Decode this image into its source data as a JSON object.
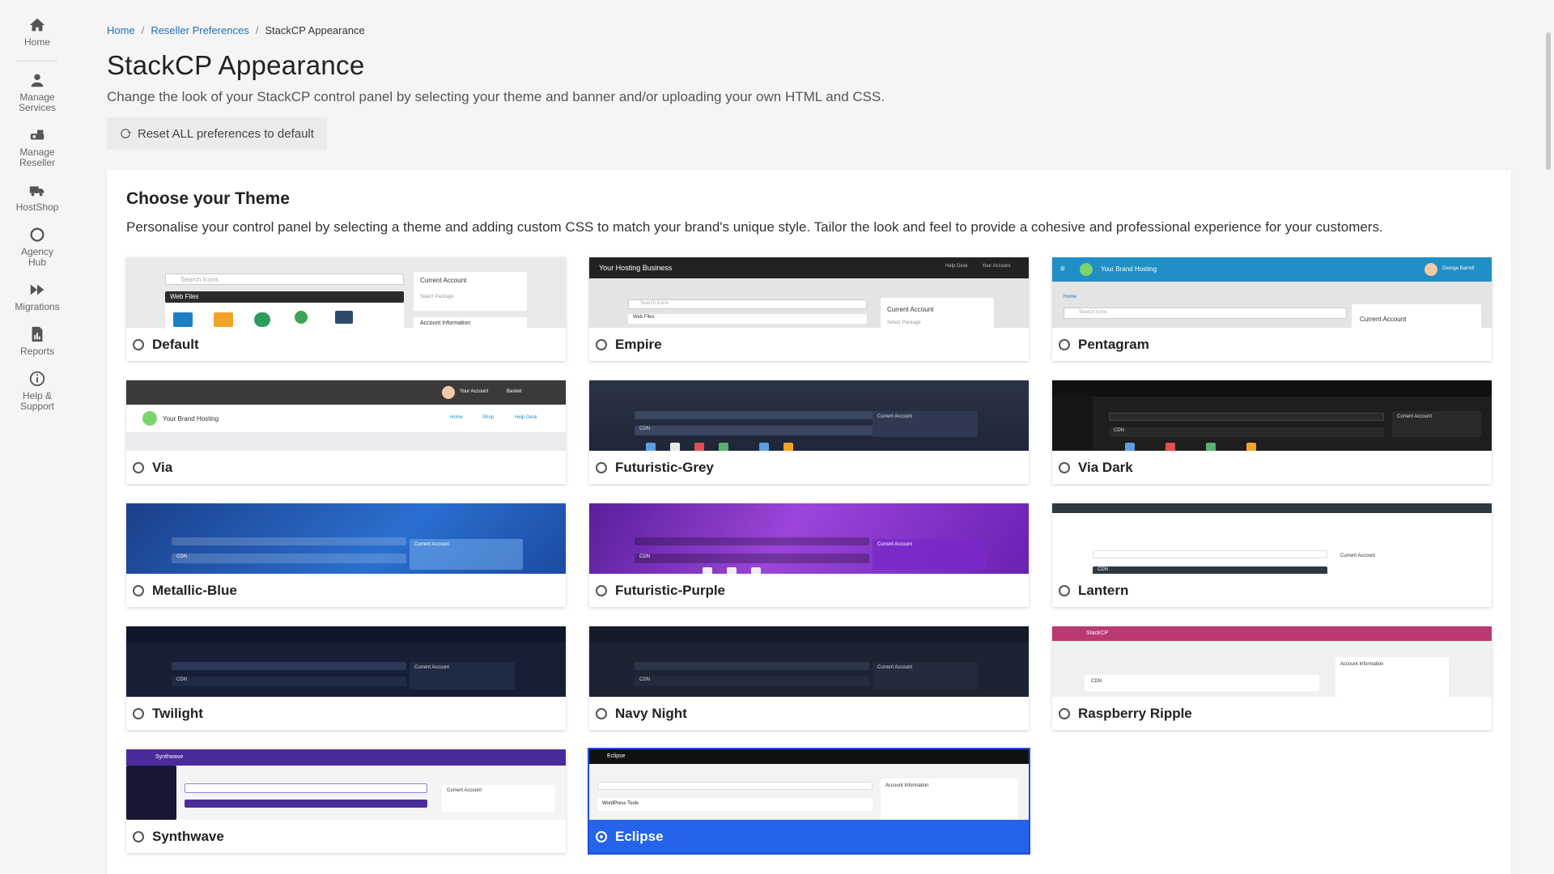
{
  "sidebar": {
    "items": [
      {
        "label": "Home",
        "icon": "home-icon"
      },
      {
        "label": "Manage Services",
        "icon": "user-gear-icon"
      },
      {
        "label": "Manage Reseller",
        "icon": "reseller-icon"
      },
      {
        "label": "HostShop",
        "icon": "truck-icon"
      },
      {
        "label": "Agency Hub",
        "icon": "circle-icon"
      },
      {
        "label": "Migrations",
        "icon": "forward-icon"
      },
      {
        "label": "Reports",
        "icon": "report-icon"
      },
      {
        "label": "Help & Support",
        "icon": "info-icon"
      }
    ]
  },
  "breadcrumb": {
    "home": "Home",
    "parent": "Reseller Preferences",
    "current": "StackCP Appearance",
    "sep": "/"
  },
  "page": {
    "title": "StackCP Appearance",
    "subtitle": "Change the look of your StackCP control panel by selecting your theme and banner and/or uploading your own HTML and CSS.",
    "reset_label": "Reset ALL preferences to default"
  },
  "themes_card": {
    "title": "Choose your Theme",
    "description": "Personalise your control panel by selecting a theme and adding custom CSS to match your brand's unique style. Tailor the look and feel to provide a cohesive and professional experience for your customers.",
    "selected": "Eclipse",
    "themes": [
      {
        "name": "Default",
        "preview_texts": [
          "Search Icons",
          "Web Files",
          "Current Account",
          "Select Package",
          "Account Information"
        ]
      },
      {
        "name": "Empire",
        "preview_texts": [
          "Your Hosting Business",
          "Help Desk",
          "Your Account",
          "Search Icons",
          "Web Files",
          "Current Account",
          "Select Package"
        ]
      },
      {
        "name": "Pentagram",
        "preview_texts": [
          "Your Brand Hosting",
          "George Barrett",
          "Home",
          "Search Icons",
          "Current Account"
        ]
      },
      {
        "name": "Via",
        "preview_texts": [
          "Your Account",
          "Basket",
          "Your Brand Hosting",
          "Home",
          "Shop",
          "Help Desk"
        ]
      },
      {
        "name": "Futuristic-Grey",
        "preview_texts": [
          "Current Account",
          "CDN"
        ]
      },
      {
        "name": "Via Dark",
        "preview_texts": [
          "Current Account",
          "CDN"
        ]
      },
      {
        "name": "Metallic-Blue",
        "preview_texts": [
          "Current Account",
          "CDN"
        ]
      },
      {
        "name": "Futuristic-Purple",
        "preview_texts": [
          "Current Account",
          "CDN"
        ]
      },
      {
        "name": "Lantern",
        "preview_texts": [
          "Current Account",
          "CDN"
        ]
      },
      {
        "name": "Twilight",
        "preview_texts": [
          "Current Account",
          "CDN"
        ]
      },
      {
        "name": "Navy Night",
        "preview_texts": [
          "Current Account",
          "CDN"
        ]
      },
      {
        "name": "Raspberry Ripple",
        "preview_texts": [
          "StackCP",
          "Account Information",
          "CDN"
        ]
      },
      {
        "name": "Synthwave",
        "preview_texts": [
          "Synthwave",
          "Current Account"
        ]
      },
      {
        "name": "Eclipse",
        "preview_texts": [
          "Eclipse",
          "Account Information",
          "WordPress Tools"
        ]
      }
    ]
  },
  "colors": {
    "link": "#1f6fb5",
    "selected": "#2563eb"
  }
}
